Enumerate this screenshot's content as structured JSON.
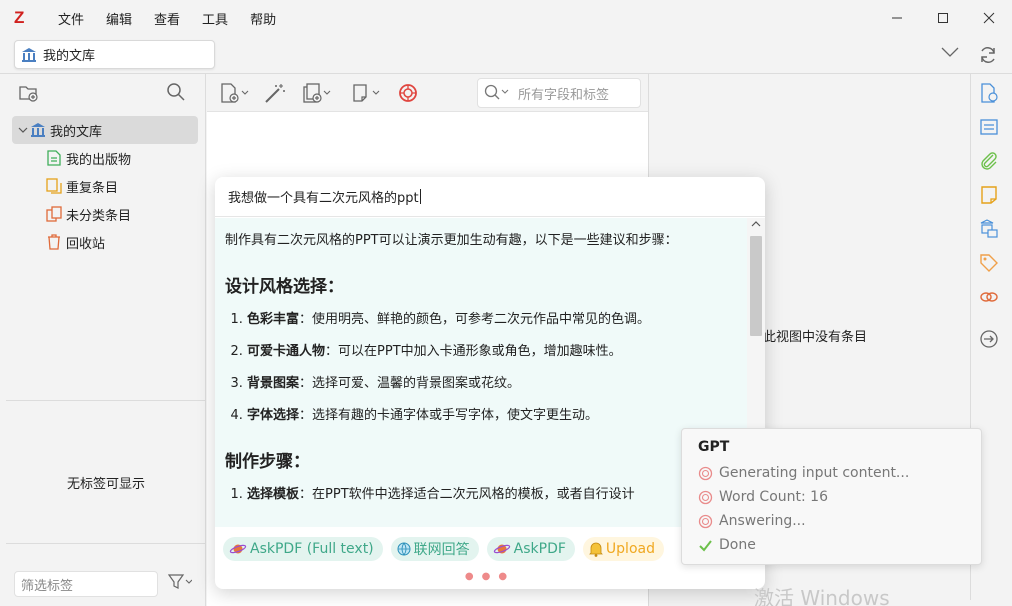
{
  "app": {
    "logo": "Z",
    "menu": [
      "文件",
      "编辑",
      "查看",
      "工具",
      "帮助"
    ]
  },
  "tab": {
    "label": "我的文库"
  },
  "collections": {
    "root": "我的文库",
    "children": [
      "我的出版物",
      "重复条目",
      "未分类条目",
      "回收站"
    ]
  },
  "tags": {
    "empty_text": "无标签可显示",
    "filter_placeholder": "筛选标签"
  },
  "items": {
    "search_placeholder": "所有字段和标签",
    "empty_message": "此视图中没有条目"
  },
  "chat": {
    "input_value": "我想做一个具有二次元风格的ppt",
    "intro": "制作具有二次元风格的PPT可以让演示更加生动有趣，以下是一些建议和步骤：",
    "section1_title": "设计风格选择：",
    "section1_items": [
      {
        "bold": "色彩丰富",
        "text": "：使用明亮、鲜艳的颜色，可参考二次元作品中常见的色调。"
      },
      {
        "bold": "可爱卡通人物",
        "text": "：可以在PPT中加入卡通形象或角色，增加趣味性。"
      },
      {
        "bold": "背景图案",
        "text": "：选择可爱、温馨的背景图案或花纹。"
      },
      {
        "bold": "字体选择",
        "text": "：选择有趣的卡通字体或手写字体，使文字更生动。"
      }
    ],
    "section2_title": "制作步骤：",
    "section2_items": [
      {
        "bold": "选择模板",
        "text": "：在PPT软件中选择适合二次元风格的模板，或者自行设计"
      }
    ],
    "actions": [
      "AskPDF (Full text)",
      "联网回答",
      "AskPDF",
      "Upload"
    ]
  },
  "gpt_status": {
    "title": "GPT",
    "lines": [
      "Generating input content...",
      "Word Count: 16",
      "Answering...",
      "Done"
    ]
  },
  "watermark": "激活 Windows",
  "colors": {
    "brand": "#d0201e",
    "accent": "#4a90d9",
    "teal": "#3fa889",
    "chat_bg": "#f0faf9"
  }
}
